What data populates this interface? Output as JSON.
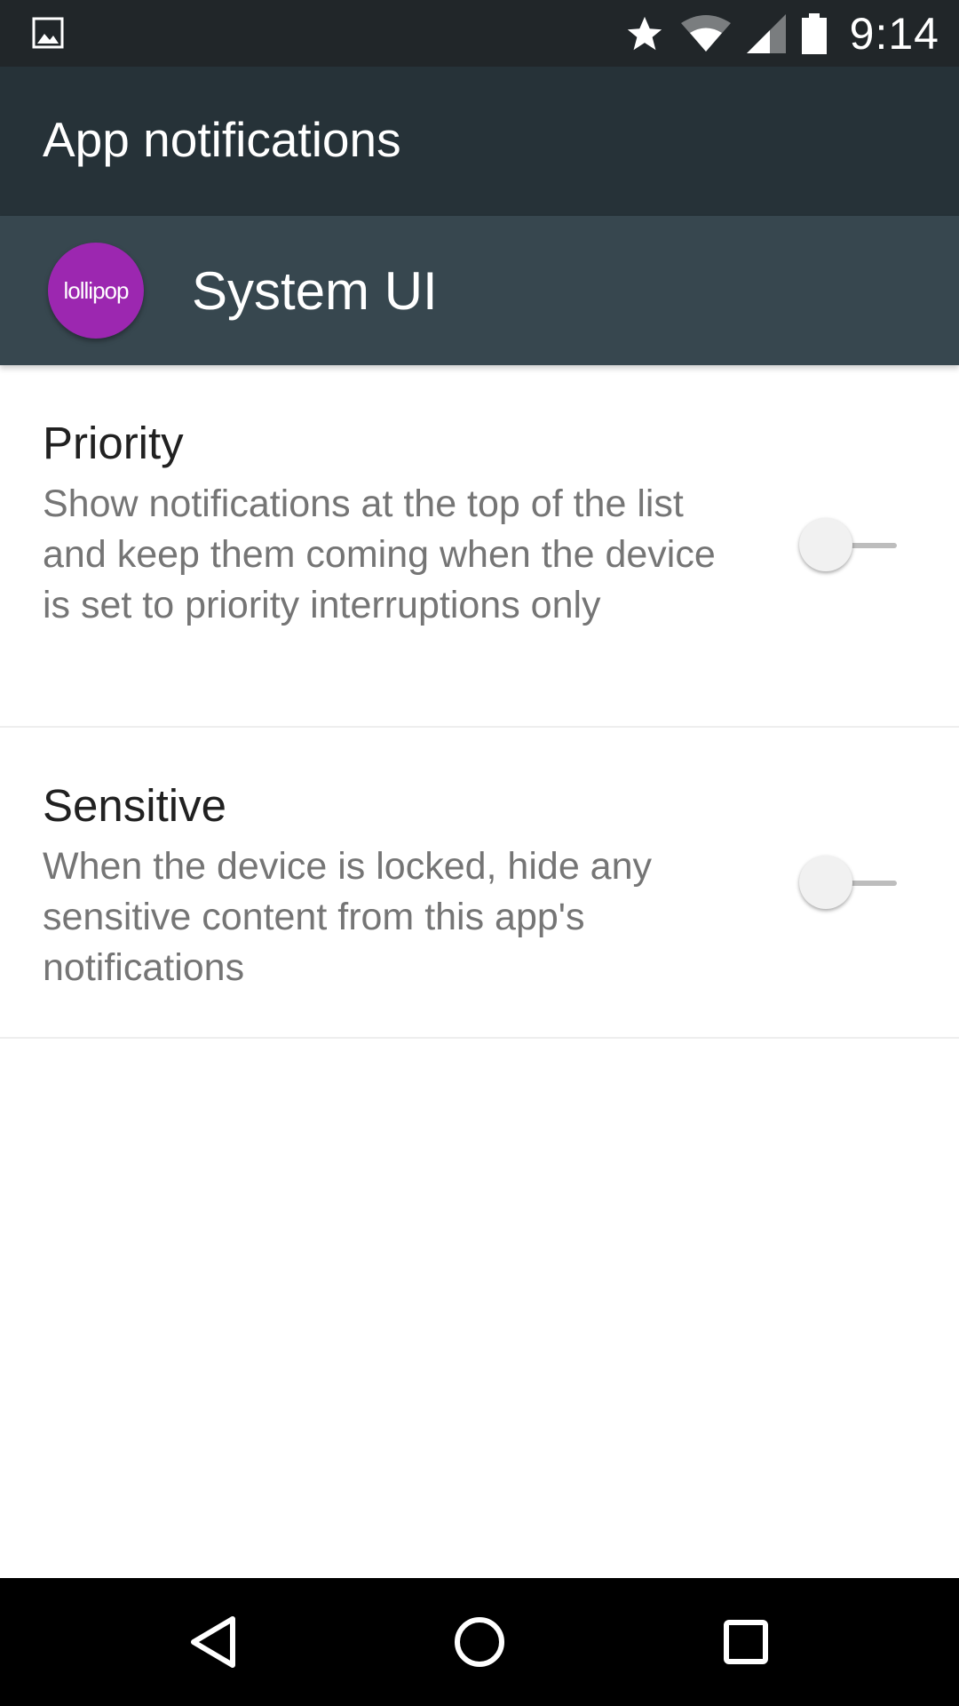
{
  "status_bar": {
    "time": "9:14",
    "icons": [
      "gallery-icon",
      "star-icon",
      "wifi-icon",
      "cell-signal-icon",
      "battery-icon"
    ]
  },
  "app_bar": {
    "title": "App notifications"
  },
  "app_header": {
    "icon_label": "lollipop",
    "icon_color": "#9c27b0",
    "app_name": "System UI"
  },
  "settings": [
    {
      "title": "Priority",
      "summary": "Show notifications at the top of the list and keep them coming when the device is set to priority interruptions only",
      "enabled": false
    },
    {
      "title": "Sensitive",
      "summary": "When the device is locked, hide any sensitive content from this app's notifications",
      "enabled": false
    }
  ],
  "nav_bar": {
    "buttons": [
      "back-icon",
      "home-icon",
      "recents-icon"
    ]
  },
  "colors": {
    "status_bar": "#212629",
    "app_bar": "#263238",
    "app_header": "#37474f"
  }
}
